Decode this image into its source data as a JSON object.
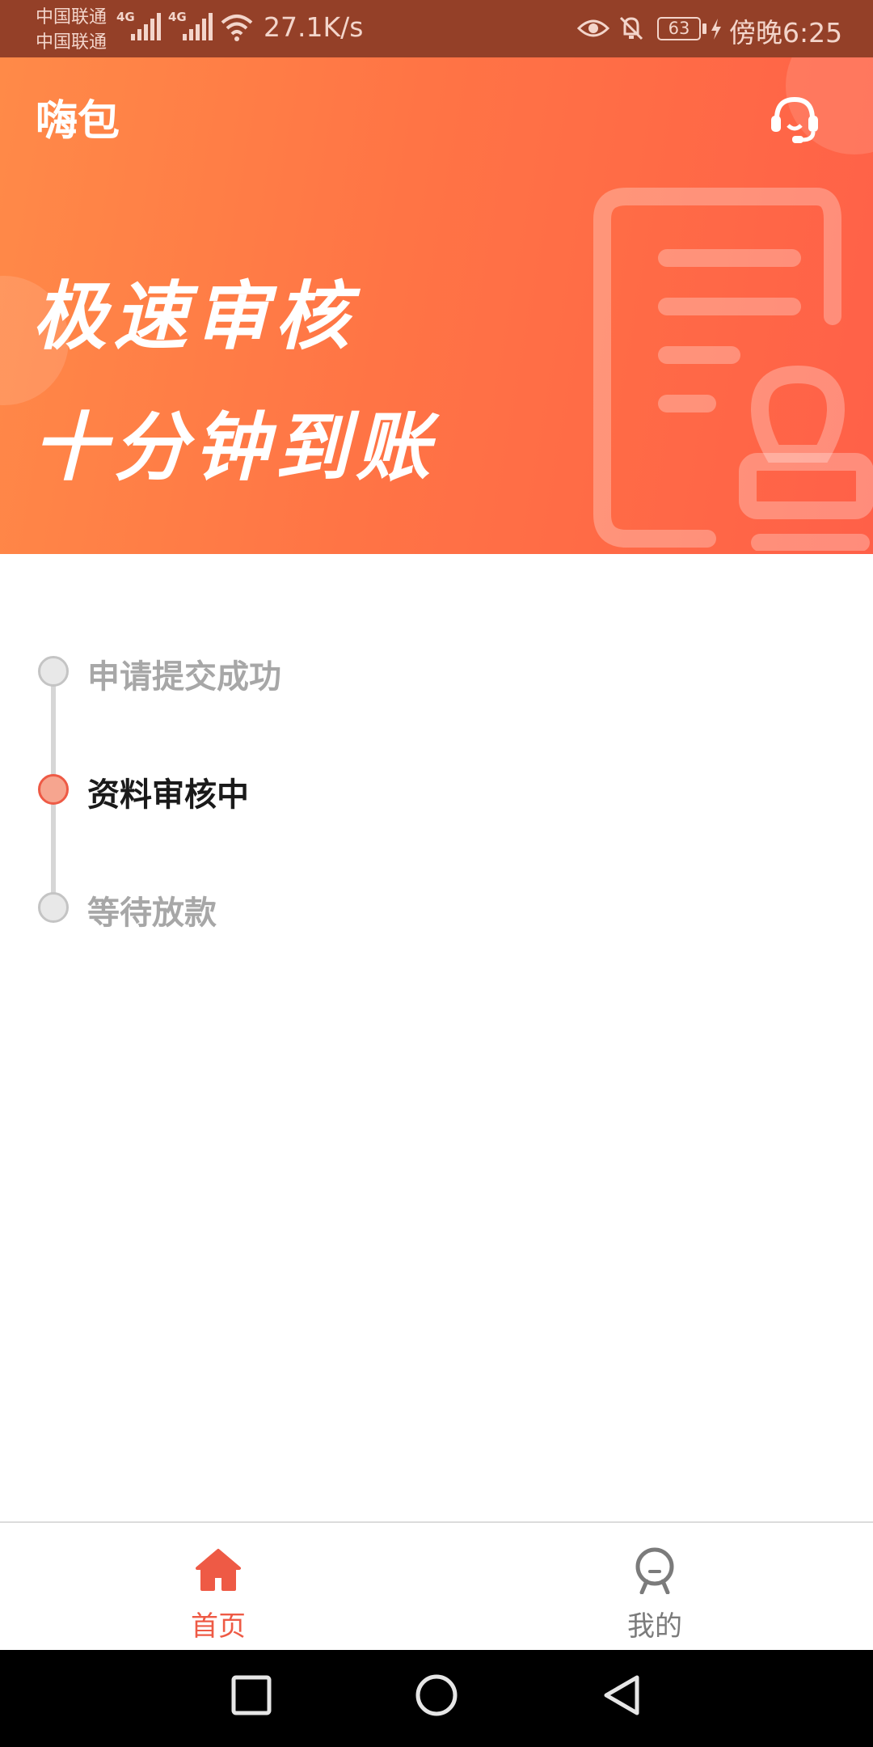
{
  "status_bar": {
    "carrier_1": "中国联通",
    "carrier_2": "中国联通",
    "net_1": "4G",
    "net_2": "4G",
    "speed": "27.1K/s",
    "battery": "63",
    "time": "傍晚6:25"
  },
  "header": {
    "app_title": "嗨包",
    "support_icon": "headset-icon"
  },
  "banner": {
    "line_1": "极速审核",
    "line_2": "十分钟到账",
    "illustration": "document-stamp-icon"
  },
  "steps": [
    {
      "label": "申请提交成功",
      "state": "done"
    },
    {
      "label": "资料审核中",
      "state": "active"
    },
    {
      "label": "等待放款",
      "state": "pending"
    }
  ],
  "tabs": [
    {
      "label": "首页",
      "icon": "home-icon",
      "active": true
    },
    {
      "label": "我的",
      "icon": "profile-icon",
      "active": false
    }
  ],
  "colors": {
    "accent": "#ee5a45",
    "banner_start": "#ff8a48",
    "banner_end": "#ff6048",
    "inactive_text": "#a7a7a7"
  },
  "system_nav": [
    "recents-icon",
    "home-circle-icon",
    "back-icon"
  ]
}
